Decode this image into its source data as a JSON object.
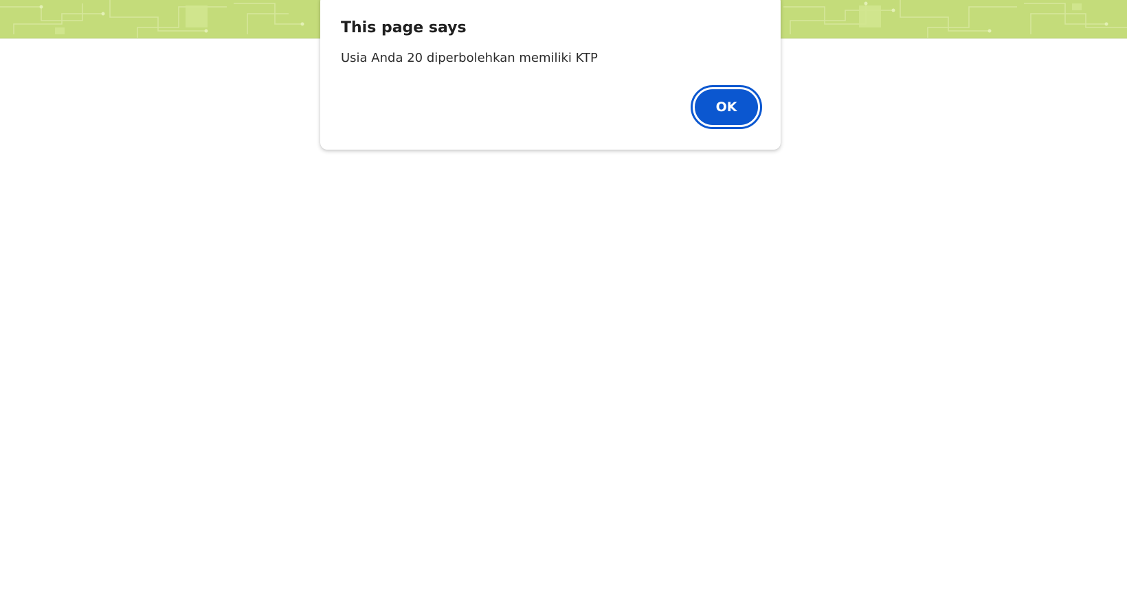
{
  "banner": {
    "pattern_icon": "circuit-pattern-icon",
    "background_color": "#c4dc7a",
    "trace_color": "#dbeaa6"
  },
  "dialog": {
    "title": "This page says",
    "message": "Usia Anda 20 diperbolehkan memiliki KTP",
    "ok_label": "OK",
    "accent_color": "#0b57d0"
  }
}
